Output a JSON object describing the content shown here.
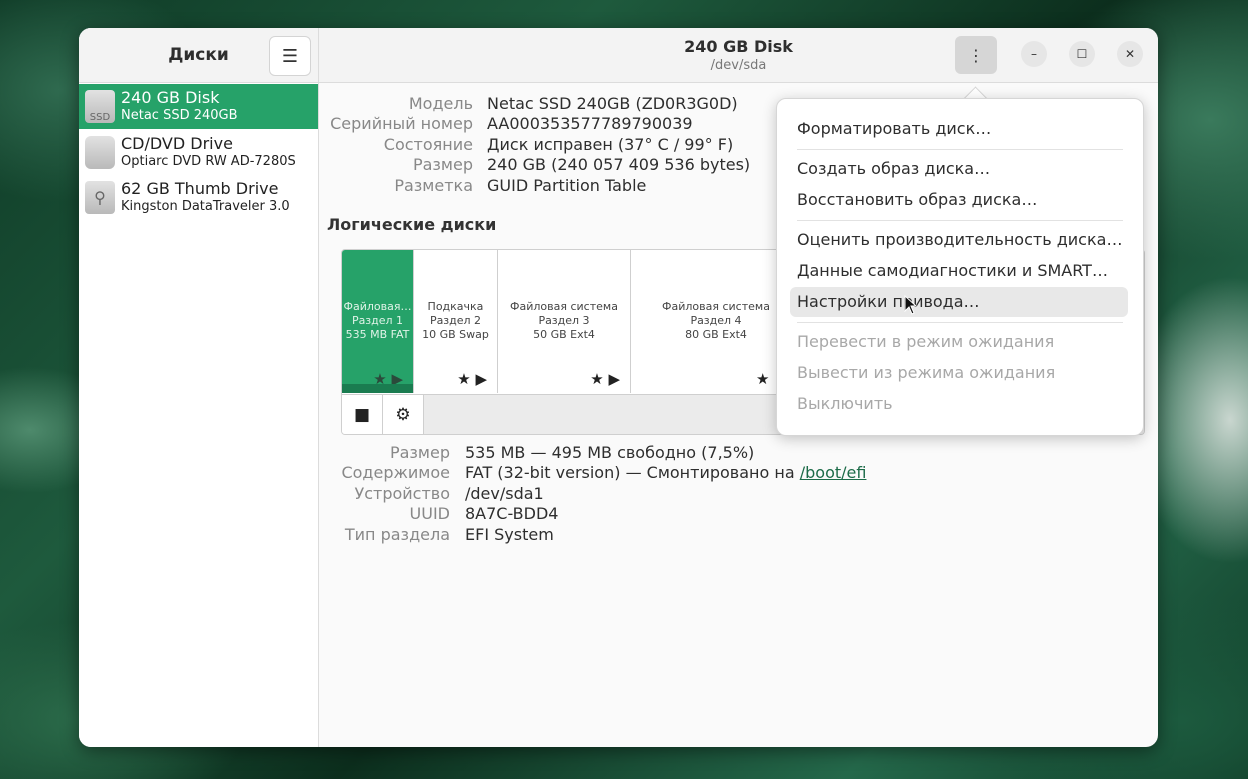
{
  "sidebar": {
    "title": "Диски",
    "drives": [
      {
        "name": "240 GB Disk",
        "model": "Netac SSD 240GB",
        "icon": "ssd-icon",
        "icon_text": "SSD"
      },
      {
        "name": "CD/DVD Drive",
        "model": "Optiarc DVD RW AD-7280S",
        "icon": "optical-drive-icon",
        "icon_text": ""
      },
      {
        "name": "62 GB Thumb Drive",
        "model": "Kingston DataTraveler 3.0",
        "icon": "usb-drive-icon",
        "icon_text": "⚲"
      }
    ]
  },
  "header": {
    "title": "240 GB Disk",
    "subtitle": "/dev/sda",
    "kebab": "⋮",
    "minimize": "–",
    "maximize": "☐",
    "close": "✕"
  },
  "disk_info": [
    {
      "label": "Модель",
      "value": "Netac SSD 240GB (ZD0R3G0D)"
    },
    {
      "label": "Серийный номер",
      "value": "AA000353577789790039"
    },
    {
      "label": "Состояние",
      "value": "Диск исправен (37° C / 99° F)"
    },
    {
      "label": "Размер",
      "value": "240 GB (240 057 409 536 bytes)"
    },
    {
      "label": "Разметка",
      "value": "GUID Partition Table"
    }
  ],
  "volumes": {
    "title": "Логические диски",
    "partitions": [
      {
        "line1": "Файловая…",
        "line2": "Раздел 1",
        "line3": "535 MB FAT",
        "marks": "★ ▶",
        "selected": true
      },
      {
        "line1": "Подкачка",
        "line2": "Раздел 2",
        "line3": "10 GB Swap",
        "marks": "★ ▶",
        "selected": false
      },
      {
        "line1": "Файловая система",
        "line2": "Раздел 3",
        "line3": "50 GB Ext4",
        "marks": "★ ▶",
        "selected": false
      },
      {
        "line1": "Файловая система",
        "line2": "Раздел 4",
        "line3": "80 GB Ext4",
        "marks": "★",
        "selected": false
      }
    ],
    "toolbar": {
      "stop": "■",
      "settings": "⚙"
    }
  },
  "partition_details": {
    "size_label": "Размер",
    "size_value": "535 MB — 495 MB свободно (7,5%)",
    "content_label": "Содержимое",
    "content_value": "FAT (32-bit version) — Смонтировано на ",
    "mount_link": "/boot/efi",
    "device_label": "Устройство",
    "device_value": "/dev/sda1",
    "uuid_label": "UUID",
    "uuid_value": "8A7C-BDD4",
    "type_label": "Тип раздела",
    "type_value": "EFI System"
  },
  "menu": {
    "format": "Форматировать диск…",
    "create_image": "Создать образ диска…",
    "restore_image": "Восстановить образ диска…",
    "benchmark": "Оценить производительность диска…",
    "smart": "Данные самодиагностики и SMART…",
    "drive_settings": "Настройки привода…",
    "standby": "Перевести в режим ожидания",
    "wakeup": "Вывести из режима ожидания",
    "poweroff": "Выключить"
  }
}
